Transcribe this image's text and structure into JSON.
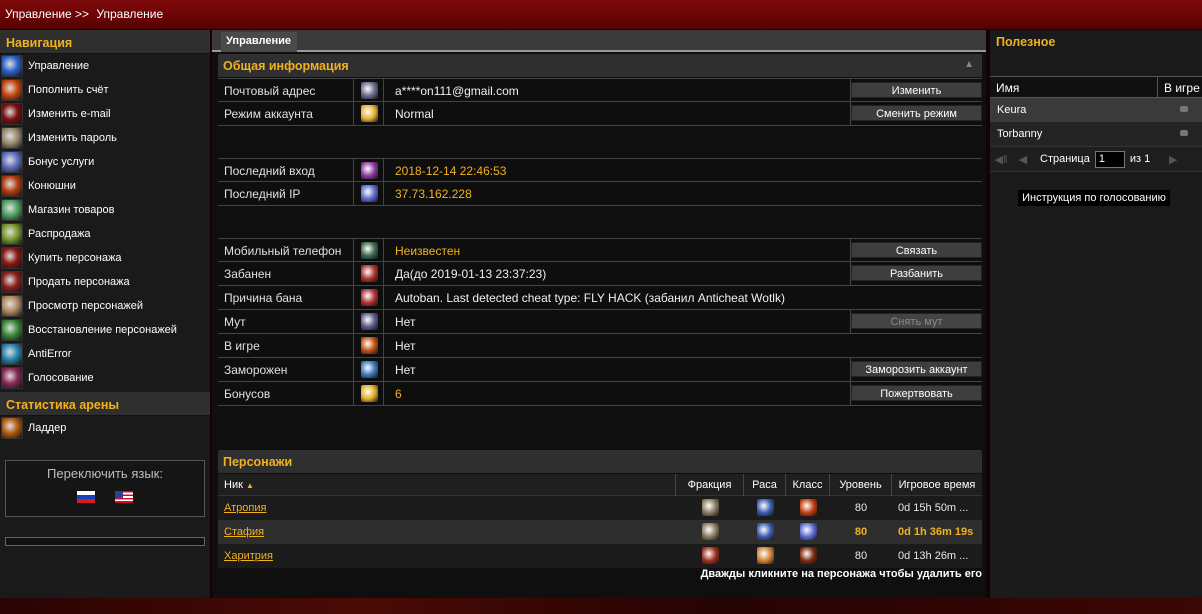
{
  "topbar": {
    "crumb1": "Управление >>",
    "crumb2": "Управление"
  },
  "nav": {
    "title": "Навигация",
    "items": [
      {
        "label": "Управление",
        "icon": "control-icon",
        "color": "#2c63c8"
      },
      {
        "label": "Пополнить счёт",
        "icon": "fire-icon",
        "color": "#c54710"
      },
      {
        "label": "Изменить e-mail",
        "icon": "demon-icon",
        "color": "#7a1010"
      },
      {
        "label": "Изменить пароль",
        "icon": "portrait-icon",
        "color": "#9a8a70"
      },
      {
        "label": "Бонус услуги",
        "icon": "swords-icon",
        "color": "#5e6fc0"
      },
      {
        "label": "Конюшни",
        "icon": "mount-icon",
        "color": "#b23e10"
      },
      {
        "label": "Магазин товаров",
        "icon": "orb-icon",
        "color": "#4fa063"
      },
      {
        "label": "Распродажа",
        "icon": "tree-icon",
        "color": "#7a9a30"
      },
      {
        "label": "Купить персонажа",
        "icon": "rage-icon",
        "color": "#8a1a12"
      },
      {
        "label": "Продать персонажа",
        "icon": "claw-icon",
        "color": "#8a1f1f"
      },
      {
        "label": "Просмотр персонажей",
        "icon": "face-icon",
        "color": "#b08860"
      },
      {
        "label": "Восстановление персонажей",
        "icon": "nature-icon",
        "color": "#3a8a3a"
      },
      {
        "label": "AntiError",
        "icon": "vortex-icon",
        "color": "#2a84b0"
      },
      {
        "label": "Голосование",
        "icon": "cross-icon",
        "color": "#8a2a5a"
      }
    ]
  },
  "arena": {
    "title": "Статистика арены",
    "items": [
      {
        "label": "Ладдер",
        "icon": "ladder-icon",
        "color": "#b05a10"
      }
    ]
  },
  "language": {
    "label": "Переключить язык:",
    "flags": [
      "ru-flag-icon",
      "us-flag-icon"
    ]
  },
  "tabs": {
    "active": "Управление"
  },
  "general": {
    "title": "Общая информация",
    "email": {
      "label": "Почтовый адрес",
      "value": "a****on111@gmail.com",
      "button": "Изменить",
      "icon": "mail-icon",
      "color": "#6a6a8a"
    },
    "mode": {
      "label": "Режим аккаунта",
      "value": "Normal",
      "button": "Сменить режим",
      "icon": "star-icon",
      "color": "#e6b030"
    },
    "last_login": {
      "label": "Последний вход",
      "value": "2018-12-14 22:46:53",
      "icon": "portal-icon",
      "color": "#8a3aa0"
    },
    "last_ip": {
      "label": "Последний IP",
      "value": "37.73.162.228",
      "icon": "network-icon",
      "color": "#5a6ad0"
    },
    "phone": {
      "label": "Мобильный телефон",
      "value": "Неизвестен",
      "button": "Связать",
      "icon": "phone-icon",
      "color": "#3a6a50"
    },
    "banned": {
      "label": "Забанен",
      "value": "Да(до 2019-01-13 23:37:23)",
      "button": "Разбанить",
      "icon": "ban-hand-icon",
      "color": "#b03030"
    },
    "ban_reason": {
      "label": "Причина бана",
      "value": "Autoban. Last detected cheat type: FLY HACK (забанил Anticheat Wotlk)",
      "icon": "ban-hand-icon",
      "color": "#b03030"
    },
    "mute": {
      "label": "Мут",
      "value": "Нет",
      "button": "Снять мут",
      "icon": "mute-icon",
      "color": "#5a5a8a"
    },
    "ingame": {
      "label": "В игре",
      "value": "Нет",
      "icon": "sprint-icon",
      "color": "#c05010"
    },
    "frozen": {
      "label": "Заморожен",
      "value": "Нет",
      "button": "Заморозить аккаунт",
      "icon": "frost-icon",
      "color": "#3a78c0"
    },
    "bonus": {
      "label": "Бонусов",
      "value": "6",
      "button": "Пожертвовать",
      "icon": "coin-icon",
      "color": "#e0b020"
    }
  },
  "characters": {
    "title": "Персонажи",
    "columns": [
      "Ник",
      "Фракция",
      "Раса",
      "Класс",
      "Уровень",
      "Игровое время"
    ],
    "rows": [
      {
        "name": "Атропия",
        "faction_icon": "alliance-icon",
        "faction_color": "#8a7a60",
        "race_icon": "race-icon",
        "race_color": "#3a5ab0",
        "class_icon": "class-icon",
        "class_color": "#c04010",
        "level": "80",
        "time": "0d 15h 50m ..."
      },
      {
        "name": "Стафия",
        "faction_icon": "alliance-icon",
        "faction_color": "#8a7a60",
        "race_icon": "race-icon",
        "race_color": "#3a5ab0",
        "class_icon": "class-icon",
        "class_color": "#5a6ad0",
        "level": "80",
        "time": "0d 1h 36m 19s"
      },
      {
        "name": "Харитрия",
        "faction_icon": "horde-icon",
        "faction_color": "#a03020",
        "race_icon": "race-icon",
        "race_color": "#d08030",
        "class_icon": "class-icon",
        "class_color": "#7a2a10",
        "level": "80",
        "time": "0d 13h 26m ..."
      }
    ],
    "hint": "Дважды кликните на персонажа чтобы удалить его"
  },
  "useful": {
    "title": "Полезное",
    "grid_headers": [
      "Имя",
      "В игре"
    ],
    "rows": [
      "Keura",
      "Torbanny"
    ],
    "pager": {
      "label": "Страница",
      "page": "1",
      "of": "из 1"
    },
    "vote_button": "Инструкция по голосованию"
  }
}
